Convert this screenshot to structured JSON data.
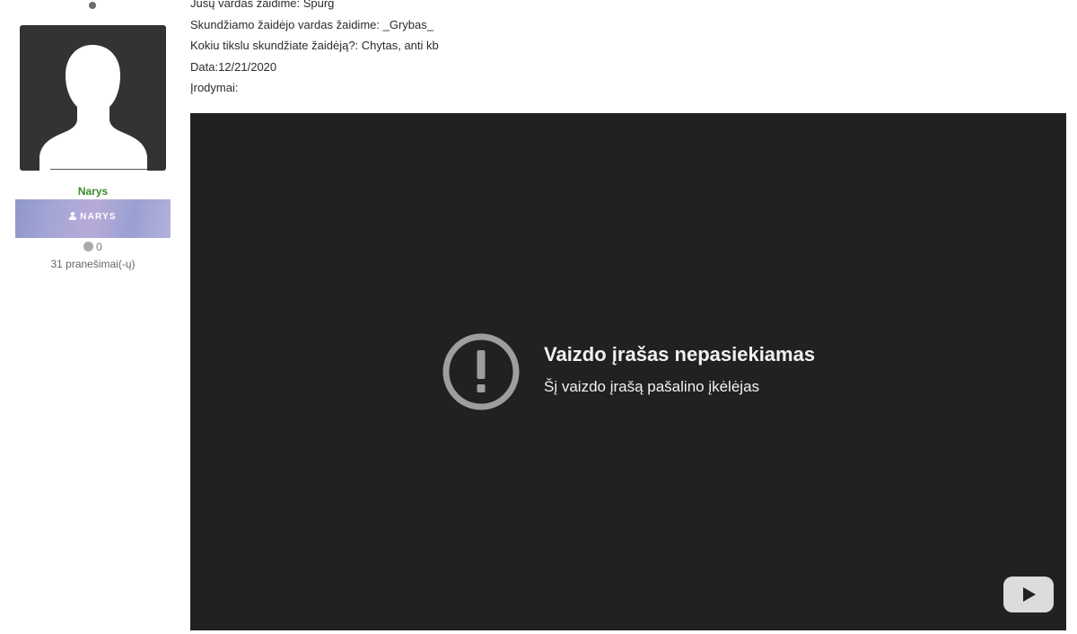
{
  "author": {
    "user_title": "Narys",
    "rank_label": "NARYS",
    "reputation": "0",
    "post_count": "31 pranešimai(-ų)"
  },
  "post": {
    "lines": [
      "Jūsų vardas žaidime: Spurg",
      "Skundžiamo žaidėjo vardas žaidime: _Grybas_",
      "Kokiu tikslu skundžiate žaidėją?: Chytas, anti kb",
      "Data:12/21/2020",
      "Įrodymai:"
    ]
  },
  "video": {
    "title": "Vaizdo įrašas nepasiekiamas",
    "subtitle": "Šį vaizdo įrašą pašalino įkėlėjas",
    "icons": [
      "alert-circle-icon",
      "youtube-logo-icon"
    ]
  },
  "colors": {
    "video_bg": "#212121",
    "user_title": "#3a8a2b",
    "avatar_bg": "#333333"
  }
}
